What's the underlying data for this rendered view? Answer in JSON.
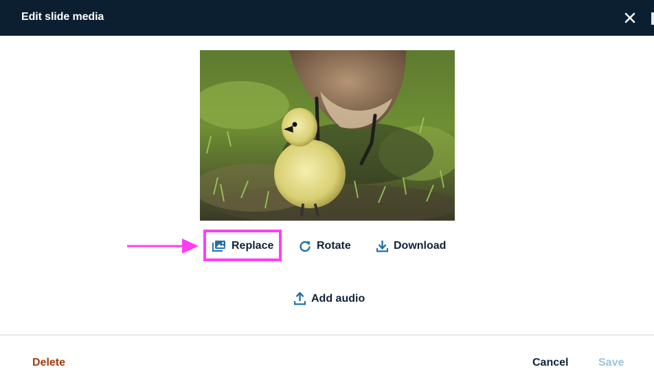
{
  "dialog": {
    "title": "Edit slide media"
  },
  "actions": {
    "replace_label": "Replace",
    "rotate_label": "Rotate",
    "download_label": "Download",
    "add_audio_label": "Add audio"
  },
  "footer": {
    "delete_label": "Delete",
    "cancel_label": "Cancel",
    "save_label": "Save"
  },
  "colors": {
    "header_bg": "#0b1f31",
    "accent_blue": "#1f6fa8",
    "highlight": "#ff3df6",
    "delete_red": "#a13a12",
    "save_disabled": "#9cc3de"
  },
  "icons": {
    "close": "close-icon",
    "replace": "image-gallery-icon",
    "rotate": "rotate-icon",
    "download": "download-icon",
    "add_audio": "upload-icon"
  }
}
